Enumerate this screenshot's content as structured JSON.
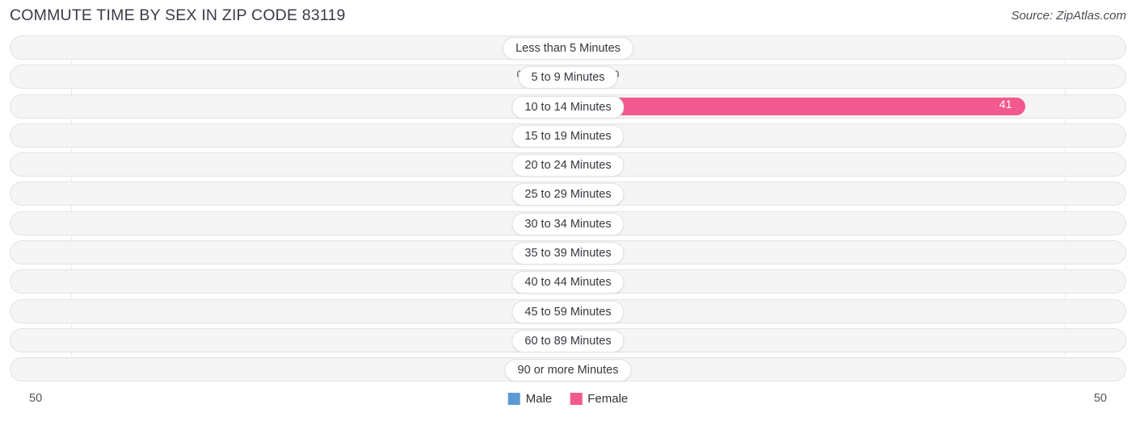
{
  "header": {
    "title": "COMMUTE TIME BY SEX IN ZIP CODE 83119",
    "source": "Source: ZipAtlas.com"
  },
  "legend": {
    "male_label": "Male",
    "female_label": "Female",
    "male_color": "#5b9bd5",
    "female_color": "#f2598f"
  },
  "axis": {
    "left_tick": "50",
    "right_tick": "50",
    "max": 50
  },
  "chart_data": {
    "type": "bar",
    "orientation": "horizontal-diverging",
    "title": "COMMUTE TIME BY SEX IN ZIP CODE 83119",
    "xlabel": "",
    "ylabel": "",
    "xlim": [
      50,
      50
    ],
    "grid": true,
    "legend_position": "bottom-center",
    "categories": [
      "Less than 5 Minutes",
      "5 to 9 Minutes",
      "10 to 14 Minutes",
      "15 to 19 Minutes",
      "20 to 24 Minutes",
      "25 to 29 Minutes",
      "30 to 34 Minutes",
      "35 to 39 Minutes",
      "40 to 44 Minutes",
      "45 to 59 Minutes",
      "60 to 89 Minutes",
      "90 or more Minutes"
    ],
    "series": [
      {
        "name": "Male",
        "values": [
          0,
          0,
          0,
          0,
          0,
          0,
          0,
          0,
          0,
          0,
          0,
          0
        ],
        "labels": [
          "0",
          "0",
          "0",
          "0",
          "0",
          "0",
          "0",
          "0",
          "0",
          "0",
          "0",
          "0"
        ]
      },
      {
        "name": "Female",
        "values": [
          0,
          0,
          41,
          0,
          0,
          0,
          0,
          0,
          0,
          0,
          0,
          0
        ],
        "labels": [
          "0",
          "0",
          "41",
          "0",
          "0",
          "0",
          "0",
          "0",
          "0",
          "0",
          "0",
          "0"
        ]
      }
    ]
  }
}
